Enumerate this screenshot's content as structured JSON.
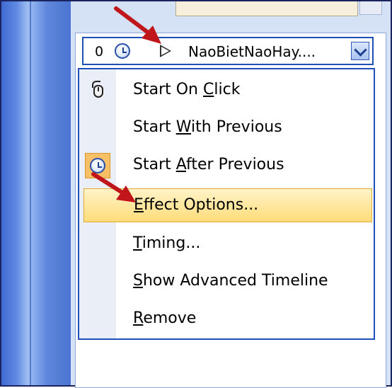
{
  "animation_item": {
    "order": "0",
    "name": "NaoBietNaoHay...."
  },
  "menu": {
    "items": [
      {
        "pre": "Start On ",
        "key": "C",
        "post": "lick"
      },
      {
        "pre": "Start ",
        "key": "W",
        "post": "ith Previous"
      },
      {
        "pre": "Start ",
        "key": "A",
        "post": "fter Previous"
      },
      {
        "pre": "",
        "key": "E",
        "post": "ffect Options..."
      },
      {
        "pre": "",
        "key": "T",
        "post": "iming..."
      },
      {
        "pre": "",
        "key": "S",
        "post": "how Advanced Timeline"
      },
      {
        "pre": "",
        "key": "R",
        "post": "emove"
      }
    ],
    "highlighted_index": 3,
    "checked_index": 2
  },
  "colors": {
    "accent_border": "#1f4fb8",
    "highlight": "#ffdc7a",
    "arrow": "#c0161b"
  }
}
